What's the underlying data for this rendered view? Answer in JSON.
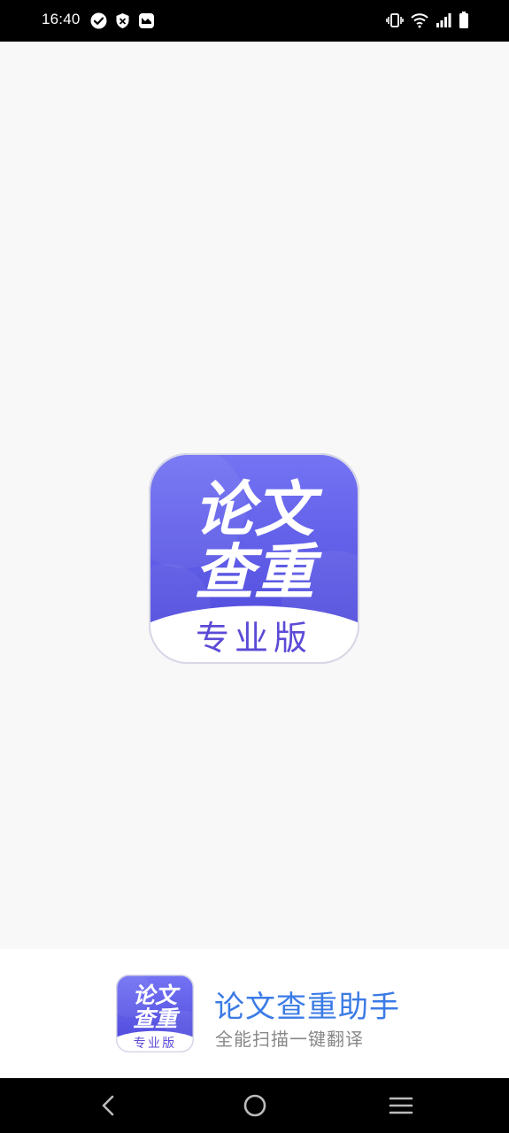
{
  "status_bar": {
    "time": "16:40",
    "left_icons": [
      "check-circle-icon",
      "shield-icon",
      "message-icon"
    ],
    "right_icons": [
      "vibrate-icon",
      "wifi-icon",
      "signal-icon",
      "battery-icon"
    ]
  },
  "splash": {
    "logo": {
      "line1": "论文",
      "line2": "查重",
      "badge": "专业版"
    }
  },
  "brand": {
    "title": "论文查重助手",
    "subtitle": "全能扫描一键翻译",
    "logo": {
      "line1": "论文",
      "line2": "查重",
      "badge": "专业版"
    }
  },
  "nav_bar": {
    "buttons": [
      "back-icon",
      "home-icon",
      "menu-icon"
    ]
  },
  "colors": {
    "logo_gradient_top": "#6f6ef3",
    "logo_gradient_bottom": "#4a44d8",
    "logo_badge_text": "#5b4bd6",
    "brand_title": "#3b7be6",
    "brand_subtitle": "#888888"
  }
}
